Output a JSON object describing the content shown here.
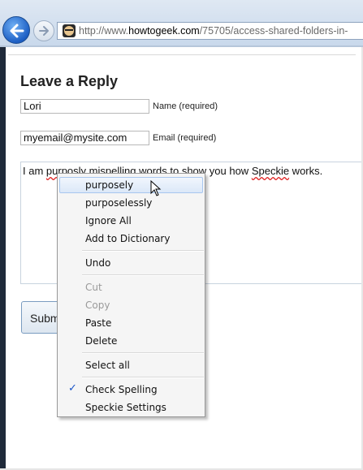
{
  "browser": {
    "url_prefix": "http://www.",
    "url_domain": "howtogeek.com",
    "url_path": "/75705/access-shared-folders-in-"
  },
  "page": {
    "heading": "Leave a Reply",
    "name_value": "Lori",
    "name_label": "Name (required)",
    "email_value": "myemail@mysite.com",
    "email_label": "Email (required)",
    "comment_before": "I am ",
    "comment_word1": "purposly",
    "comment_middle": " mispelling words to show you how ",
    "comment_word2": "Speckie",
    "comment_after": " works.",
    "submit_label": "Submit Comment"
  },
  "context_menu": {
    "suggestion_1": "purposely",
    "suggestion_2": "purposelessly",
    "ignore_all": "Ignore All",
    "add_to_dictionary": "Add to Dictionary",
    "undo": "Undo",
    "cut": "Cut",
    "copy": "Copy",
    "paste": "Paste",
    "delete": "Delete",
    "select_all": "Select all",
    "check_spelling": "Check Spelling",
    "check_spelling_checked": true,
    "speckie_settings": "Speckie Settings"
  },
  "colors": {
    "misspell_underline": "#e02020",
    "menu_highlight": "#dbe8f8",
    "back_button": "#1d5fc4"
  },
  "icons": [
    "back-arrow-icon",
    "forward-arrow-icon",
    "site-favicon-icon",
    "checkmark-icon",
    "mouse-pointer-icon"
  ]
}
